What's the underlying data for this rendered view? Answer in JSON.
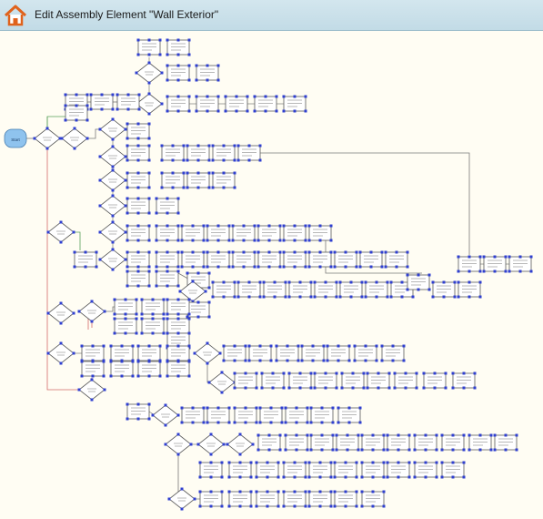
{
  "window": {
    "title": "Edit Assembly Element \"Wall Exterior\"",
    "home_icon": "home-icon"
  },
  "colors": {
    "titlebar": "#c9e0ea",
    "canvas": "#fffdf3",
    "node_border": "#5a5a5a",
    "node_fill": "#ffffff",
    "port": "#2f3fd0",
    "start_fill": "#8fc3ee",
    "edge": "#7a7a7a",
    "edge_red": "#d46a6a",
    "edge_green": "#5aa05a"
  },
  "diagram": {
    "start_label": "Start",
    "node_labels": [
      "Wall Exterior",
      "Sheathing",
      "Framing",
      "Insulation",
      "Cladding",
      "Vapor Barrier",
      "Drywall",
      "Trim"
    ]
  }
}
